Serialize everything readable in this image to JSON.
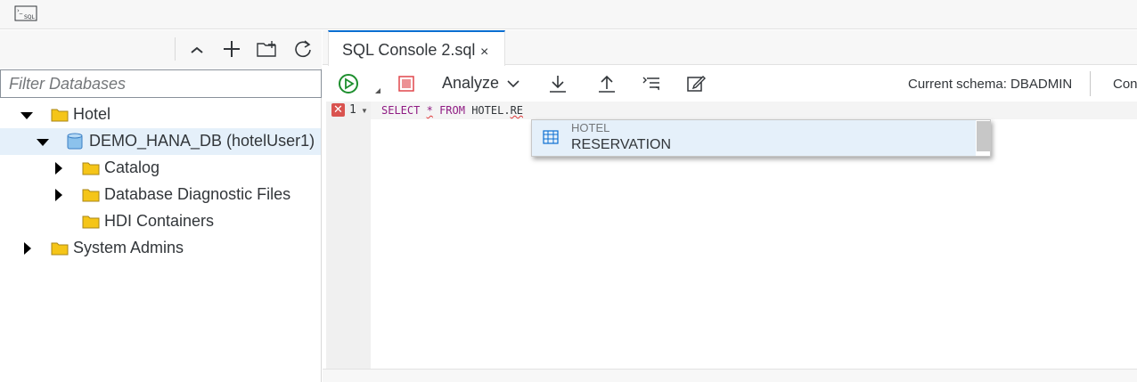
{
  "app": {
    "icon": "sql-console-icon"
  },
  "left_panel": {
    "toolbar_icons": [
      "collapse-icon",
      "add-icon",
      "add-folder-icon",
      "refresh-icon"
    ],
    "filter": {
      "placeholder": "Filter Databases"
    },
    "tree": [
      {
        "label": "Hotel",
        "expanded": true
      },
      {
        "label": "DEMO_HANA_DB (hotelUser1)",
        "expanded": true,
        "selected": true
      },
      {
        "label": "Catalog",
        "expanded": false
      },
      {
        "label": "Database Diagnostic Files",
        "expanded": false
      },
      {
        "label": "HDI Containers"
      },
      {
        "label": "System Admins",
        "expanded": false
      }
    ]
  },
  "tabs": [
    {
      "label": "SQL Console 2.sql",
      "close": "×"
    }
  ],
  "toolbar": {
    "analyze_label": "Analyze",
    "schema_text": "Current schema: DBADMIN",
    "connection_text": "Con"
  },
  "editor": {
    "line_number": "1",
    "code": {
      "kw1": "SELECT",
      "star": "*",
      "kw2": "FROM",
      "ident": "HOTEL.",
      "partial": "RE"
    }
  },
  "autocomplete": {
    "items": [
      {
        "schema": "HOTEL",
        "name": "RESERVATION"
      }
    ]
  },
  "colors": {
    "accent": "#0a6ed1",
    "run_green": "#1e8f2e",
    "stop_red": "#e0474c",
    "folder": "#f5c518",
    "error": "#d9534f"
  }
}
